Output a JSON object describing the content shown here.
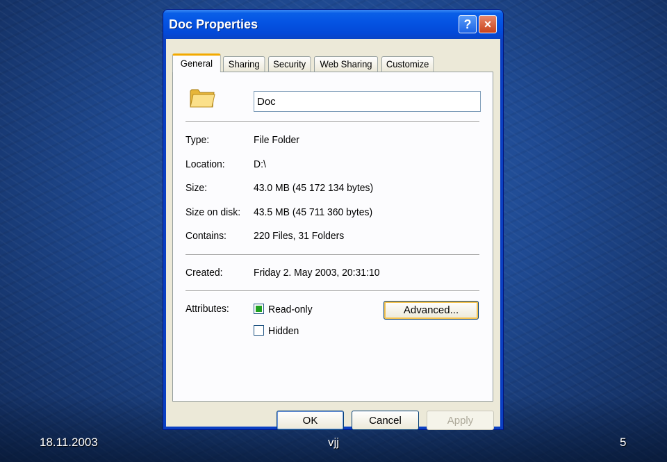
{
  "window": {
    "title": "Doc Properties",
    "help_label": "?",
    "close_label": "×"
  },
  "tabs": [
    {
      "label": "General",
      "active": true
    },
    {
      "label": "Sharing"
    },
    {
      "label": "Security"
    },
    {
      "label": "Web Sharing"
    },
    {
      "label": "Customize"
    }
  ],
  "general": {
    "name_value": "Doc",
    "fields": [
      {
        "label": "Type:",
        "value": "File Folder"
      },
      {
        "label": "Location:",
        "value": "D:\\"
      },
      {
        "label": "Size:",
        "value": "43.0 MB (45 172 134 bytes)"
      },
      {
        "label": "Size on disk:",
        "value": "43.5 MB (45 711 360 bytes)"
      },
      {
        "label": "Contains:",
        "value": "220 Files, 31 Folders"
      }
    ],
    "created": {
      "label": "Created:",
      "value": "Friday 2. May 2003, 20:31:10"
    },
    "attributes": {
      "label": "Attributes:",
      "read_only": {
        "label": "Read-only",
        "checked": true
      },
      "hidden": {
        "label": "Hidden",
        "checked": false
      },
      "advanced_label": "Advanced..."
    }
  },
  "buttons": {
    "ok": "OK",
    "cancel": "Cancel",
    "apply": "Apply"
  },
  "footer": {
    "date": "18.11.2003",
    "author": "vjj",
    "page": "5"
  },
  "colors": {
    "titlebar": "#0554e3",
    "dialog": "#ece9d8",
    "tab_highlight": "#f2a900",
    "checkbox_fill": "#21a121"
  }
}
